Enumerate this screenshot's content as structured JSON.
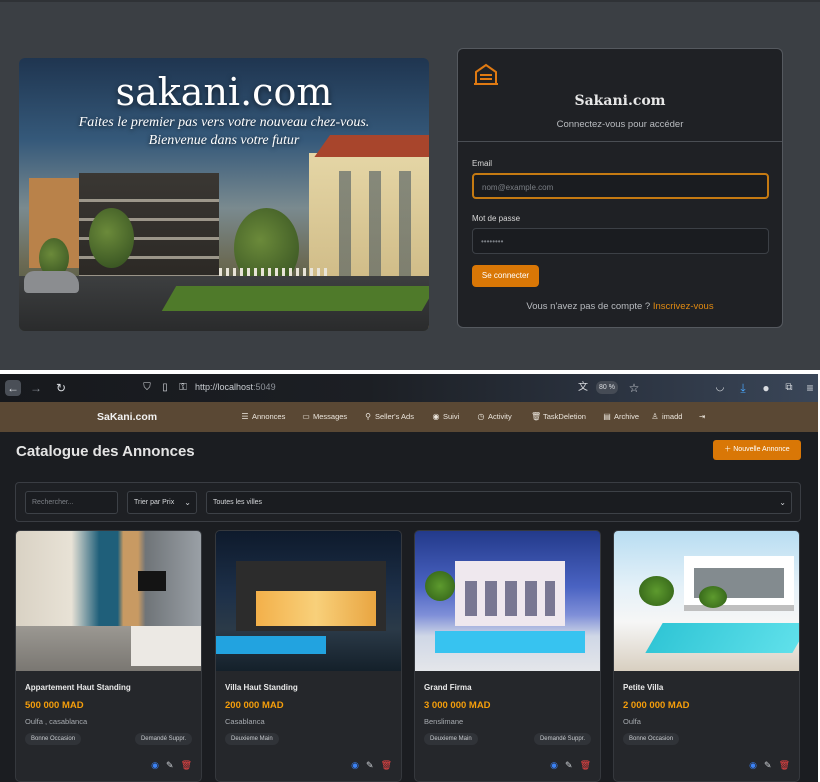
{
  "login": {
    "hero_brand": "sakani.com",
    "hero_tagline_1": "Faites le premier pas vers votre nouveau chez-vous.",
    "hero_tagline_2": "Bienvenue dans votre futur",
    "card_title": "Sakani.com",
    "card_subtitle": "Connectez-vous pour accéder",
    "email_label": "Email",
    "email_placeholder": "nom@example.com",
    "password_label": "Mot de passe",
    "password_value": "••••••••",
    "submit_label": "Se connecter",
    "no_account_text": "Vous n'avez pas de compte ?",
    "signup_link": "Inscrivez-vous",
    "accent": "#d97706"
  },
  "browser": {
    "url_host": "http://localhost",
    "url_port": ":5049",
    "zoom": "80 %"
  },
  "nav": {
    "brand": "SaKani.com",
    "items": [
      {
        "label": "Annonces",
        "icon": "list-icon"
      },
      {
        "label": "Messages",
        "icon": "chat-icon"
      },
      {
        "label": "Seller's Ads",
        "icon": "search-icon"
      },
      {
        "label": "Suivi",
        "icon": "eye-icon"
      },
      {
        "label": "Activity",
        "icon": "clock-icon"
      },
      {
        "label": "TaskDeletion",
        "icon": "trash-icon"
      },
      {
        "label": "Archive",
        "icon": "archive-icon"
      },
      {
        "label": "imadd",
        "icon": "user-icon"
      }
    ],
    "logout_icon": "logout-icon",
    "bg_color": "#5a4834"
  },
  "catalogue": {
    "title": "Catalogue des Annonces",
    "new_button": "Nouvelle Annonce",
    "search_placeholder": "Rechercher...",
    "sort_value": "Trier par Prix",
    "city_value": "Toutes les villes",
    "listings": [
      {
        "title": "Appartement Haut Standing",
        "price": "500 000 MAD",
        "location": "Oulfa , casablanca",
        "tags": [
          "Bonne Occasion",
          "Demandé Suppr."
        ]
      },
      {
        "title": "Villa Haut Standing",
        "price": "200 000 MAD",
        "location": "Casablanca",
        "tags": [
          "Deuxieme Main"
        ]
      },
      {
        "title": "Grand Firma",
        "price": "3 000 000 MAD",
        "location": "Benslimane",
        "tags": [
          "Deuxieme Main",
          "Demandé Suppr."
        ]
      },
      {
        "title": "Petite Villa",
        "price": "2 000 000 MAD",
        "location": "Oulfa",
        "tags": [
          "Bonne Occasion"
        ]
      }
    ],
    "price_color": "#f59e0b"
  }
}
